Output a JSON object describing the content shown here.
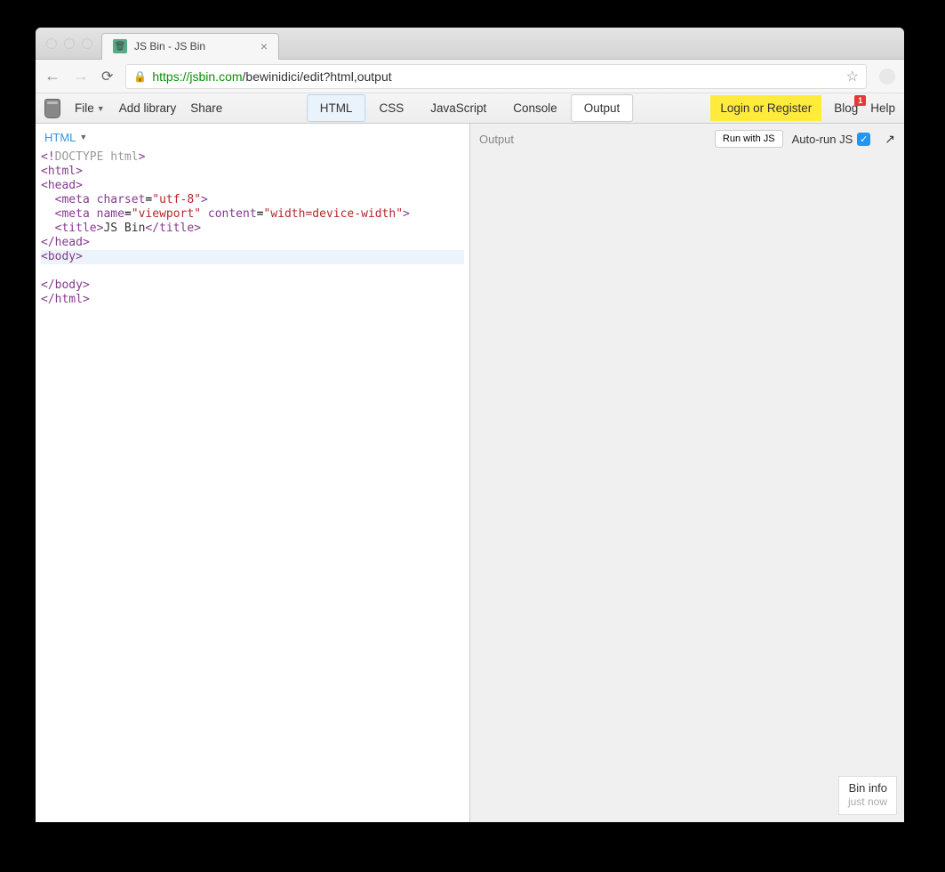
{
  "browser": {
    "tab_title": "JS Bin - JS Bin",
    "url_protocol": "https://",
    "url_host": "jsbin.com",
    "url_path": "/bewinidici/edit?html,output"
  },
  "toolbar": {
    "file_label": "File",
    "add_library_label": "Add library",
    "share_label": "Share",
    "panels": {
      "html": "HTML",
      "css": "CSS",
      "javascript": "JavaScript",
      "console": "Console",
      "output": "Output"
    },
    "login_label": "Login or Register",
    "blog_label": "Blog",
    "blog_badge": "1",
    "help_label": "Help"
  },
  "editor": {
    "pane_label": "HTML",
    "code_lines": [
      {
        "tokens": [
          {
            "c": "t-bracket",
            "t": "<!"
          },
          {
            "c": "t-doctype",
            "t": "DOCTYPE html"
          },
          {
            "c": "t-bracket",
            "t": ">"
          }
        ]
      },
      {
        "tokens": [
          {
            "c": "t-bracket",
            "t": "<"
          },
          {
            "c": "t-tag",
            "t": "html"
          },
          {
            "c": "t-bracket",
            "t": ">"
          }
        ]
      },
      {
        "tokens": [
          {
            "c": "t-bracket",
            "t": "<"
          },
          {
            "c": "t-tag",
            "t": "head"
          },
          {
            "c": "t-bracket",
            "t": ">"
          }
        ]
      },
      {
        "tokens": [
          {
            "c": "",
            "t": "  "
          },
          {
            "c": "t-bracket",
            "t": "<"
          },
          {
            "c": "t-tag",
            "t": "meta"
          },
          {
            "c": "",
            "t": " "
          },
          {
            "c": "t-attr",
            "t": "charset"
          },
          {
            "c": "",
            "t": "="
          },
          {
            "c": "t-string",
            "t": "\"utf-8\""
          },
          {
            "c": "t-bracket",
            "t": ">"
          }
        ]
      },
      {
        "tokens": [
          {
            "c": "",
            "t": "  "
          },
          {
            "c": "t-bracket",
            "t": "<"
          },
          {
            "c": "t-tag",
            "t": "meta"
          },
          {
            "c": "",
            "t": " "
          },
          {
            "c": "t-attr",
            "t": "name"
          },
          {
            "c": "",
            "t": "="
          },
          {
            "c": "t-string",
            "t": "\"viewport\""
          },
          {
            "c": "",
            "t": " "
          },
          {
            "c": "t-attr",
            "t": "content"
          },
          {
            "c": "",
            "t": "="
          },
          {
            "c": "t-string",
            "t": "\"width=device-width\""
          },
          {
            "c": "t-bracket",
            "t": ">"
          }
        ]
      },
      {
        "tokens": [
          {
            "c": "",
            "t": "  "
          },
          {
            "c": "t-bracket",
            "t": "<"
          },
          {
            "c": "t-tag",
            "t": "title"
          },
          {
            "c": "t-bracket",
            "t": ">"
          },
          {
            "c": "t-text",
            "t": "JS Bin"
          },
          {
            "c": "t-bracket",
            "t": "</"
          },
          {
            "c": "t-tag",
            "t": "title"
          },
          {
            "c": "t-bracket",
            "t": ">"
          }
        ]
      },
      {
        "tokens": [
          {
            "c": "t-bracket",
            "t": "</"
          },
          {
            "c": "t-tag",
            "t": "head"
          },
          {
            "c": "t-bracket",
            "t": ">"
          }
        ]
      },
      {
        "cursor": true,
        "tokens": [
          {
            "c": "t-bracket",
            "t": "<"
          },
          {
            "c": "t-tag",
            "t": "body"
          },
          {
            "c": "t-bracket",
            "t": ">"
          }
        ]
      },
      {
        "tokens": []
      },
      {
        "tokens": [
          {
            "c": "t-bracket",
            "t": "</"
          },
          {
            "c": "t-tag",
            "t": "body"
          },
          {
            "c": "t-bracket",
            "t": ">"
          }
        ]
      },
      {
        "tokens": [
          {
            "c": "t-bracket",
            "t": "</"
          },
          {
            "c": "t-tag",
            "t": "html"
          },
          {
            "c": "t-bracket",
            "t": ">"
          }
        ]
      }
    ]
  },
  "output": {
    "label": "Output",
    "run_btn": "Run with JS",
    "auto_run_label": "Auto-run JS"
  },
  "bin_info": {
    "title": "Bin info",
    "subtitle": "just now"
  }
}
